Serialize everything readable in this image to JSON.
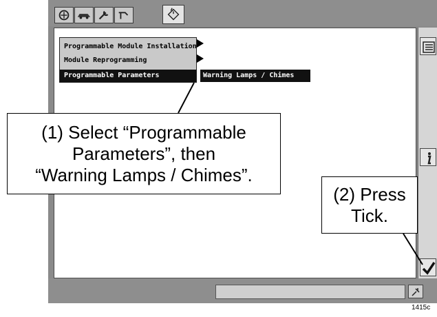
{
  "menu": {
    "items": [
      {
        "label": "Programmable Module Installation",
        "selected": false
      },
      {
        "label": "Module Reprogramming",
        "selected": false
      },
      {
        "label": "Programmable Parameters",
        "selected": true
      }
    ],
    "submenu_item": "Warning Lamps / Chimes"
  },
  "toolbar": {
    "icons": [
      "vehicle-id-icon",
      "car-icon",
      "wrench-icon",
      "tools-icon",
      "toolbox-icon"
    ]
  },
  "side_buttons": {
    "icons": [
      "list-icon",
      "info-icon",
      "tick-icon"
    ]
  },
  "callouts": {
    "step1": [
      "(1) Select “Programmable",
      "Parameters”, then",
      "“Warning Lamps / Chimes”."
    ],
    "step2": [
      "(2) Press",
      "Tick."
    ]
  },
  "figure_number": "1415c"
}
